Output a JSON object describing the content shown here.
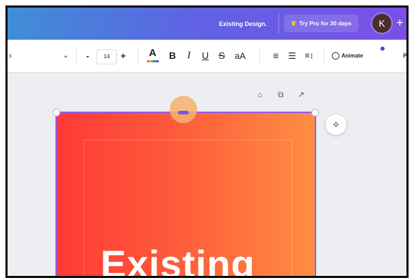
{
  "topbar": {
    "design_name": "Existing Design.",
    "try_pro": "Try Pro for 30 days",
    "avatar_initial": "K",
    "add_label": "+"
  },
  "toolbar": {
    "font_fragment": "s",
    "font_size": "14",
    "minus": "-",
    "plus": "+",
    "color_a": "A",
    "bold": "B",
    "italic": "I",
    "underline": "U",
    "strike": "S",
    "case": "aA",
    "align": "≡",
    "list": "☰",
    "spacing": "≡↕",
    "animate": "Animate",
    "position_fragment": "Po"
  },
  "canvas": {
    "heading": "Existing",
    "page_bg_start": "#fe3a36",
    "page_bg_end": "#fe8e42",
    "selection_color": "#8b5cf6"
  },
  "icons": {
    "crown": "♛",
    "chevron": "⌄",
    "lock": "⌂",
    "duplicate": "⧉",
    "add_page": "↗",
    "magic": "✧"
  }
}
